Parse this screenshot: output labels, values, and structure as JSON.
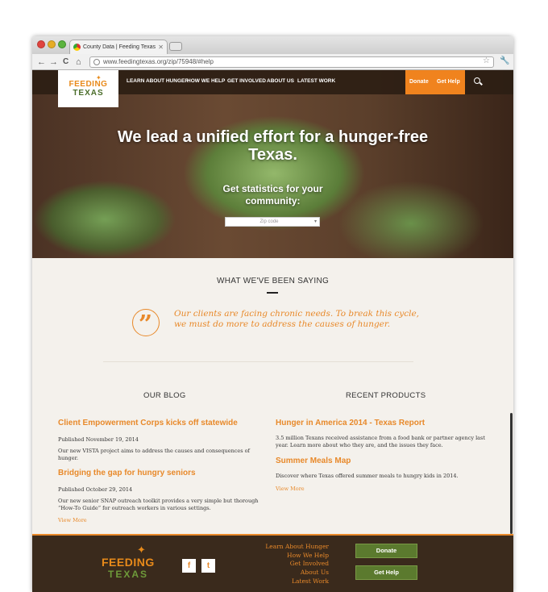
{
  "browser": {
    "tab_title": "County Data | Feeding Texas",
    "tab_close": "✕",
    "url": "www.feedingtexas.org/zip/75948/#help",
    "back_glyph": "←",
    "forward_glyph": "→",
    "reload_glyph": "C",
    "home_glyph": "⌂",
    "star_glyph": "☆",
    "wrench_glyph": "🔧"
  },
  "header": {
    "logo_line1": "FEEDING",
    "logo_line2": "TEXAS",
    "nav": [
      "LEARN ABOUT HUNGER",
      "HOW WE HELP",
      "GET INVOLVED",
      "ABOUT US",
      "LATEST WORK"
    ],
    "donate": "Donate",
    "get_help": "Get Help"
  },
  "hero": {
    "title": "We lead a unified effort for a hunger-free Texas.",
    "subtitle": "Get statistics for your community:",
    "zip_placeholder": "Zip code",
    "caret": "▾"
  },
  "saying": {
    "heading": "WHAT WE'VE BEEN SAYING",
    "quote_mark": "”",
    "quote": "Our clients are facing chronic needs. To break this cycle, we must do more to address the causes of hunger."
  },
  "blog": {
    "heading": "OUR BLOG",
    "posts": [
      {
        "title": "Client Empowerment Corps kicks off statewide",
        "published": "Published November 19, 2014",
        "body": "Our new VISTA project aims to address the causes and consequences of hunger."
      },
      {
        "title": "Bridging the gap for hungry seniors",
        "published": "Published October 29, 2014",
        "body": "Our new senior SNAP outreach toolkit provides a very simple but thorough “How-To Guide” for outreach workers in various settings."
      }
    ],
    "view_more": "View More"
  },
  "products": {
    "heading": "RECENT PRODUCTS",
    "items": [
      {
        "title": "Hunger in America 2014 - Texas Report",
        "body": "3.5 million Texans received assistance from a food bank or partner agency last year. Learn more about who they are, and the issues they face."
      },
      {
        "title": "Summer Meals Map",
        "body": "Discover where Texas offered summer meals to hungry kids in 2014."
      }
    ],
    "view_more": "View More"
  },
  "footer": {
    "logo_line1": "FEEDING",
    "logo_line2": "TEXAS",
    "facebook": "f",
    "twitter": "t",
    "links": [
      "Learn About Hunger",
      "How We Help",
      "Get Involved",
      "About Us",
      "Latest Work"
    ],
    "donate": "Donate",
    "get_help": "Get Help"
  },
  "colors": {
    "accent_orange": "#e8892a",
    "footer_brown": "#3a2a1c",
    "button_green": "#5b7a2e"
  }
}
